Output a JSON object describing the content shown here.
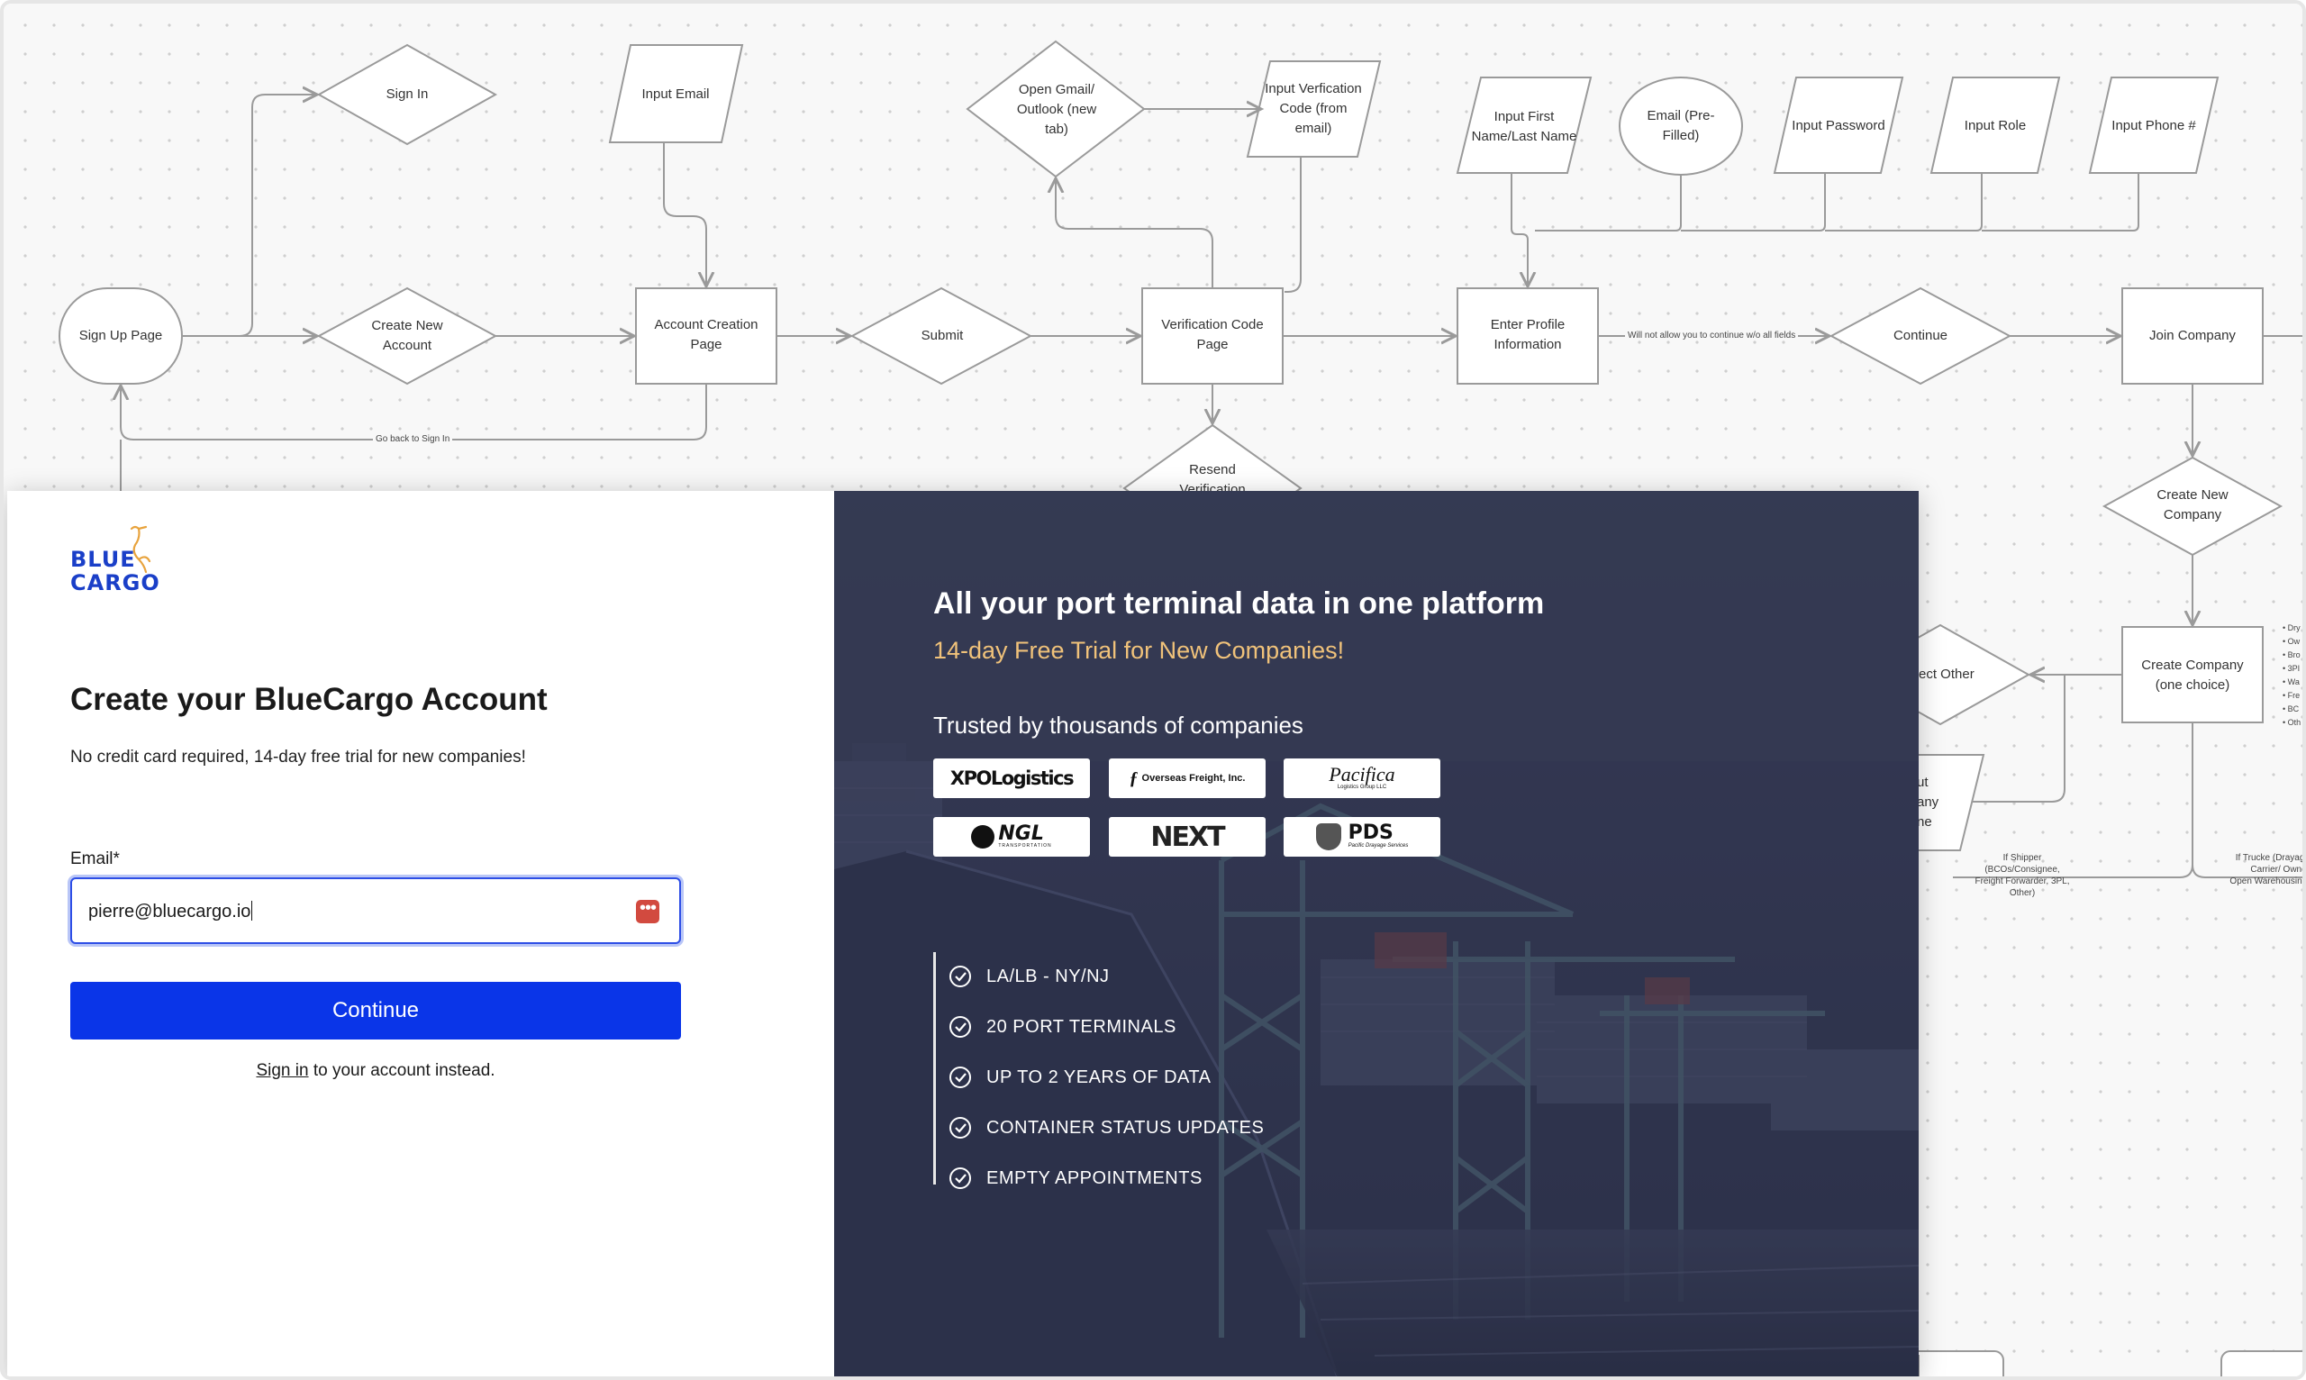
{
  "flowchart": {
    "nodes": {
      "sign_up_page": "Sign Up Page",
      "sign_in": "Sign In",
      "create_new_account": "Create New Account",
      "input_email": "Input Email",
      "account_creation_page": "Account Creation Page",
      "submit": "Submit",
      "open_gmail": "Open Gmail/ Outlook (new tab)",
      "input_verification_code": "Input Verfication Code (from email)",
      "verification_code_page": "Verification Code Page",
      "resend_verification": "Resend Verification",
      "input_first_last_name": "Input First Name/Last Name",
      "email_prefilled": "Email (Pre-Filled)",
      "input_password": "Input Password",
      "input_role": "Input Role",
      "input_phone": "Input Phone #",
      "enter_profile_information": "Enter Profile Information",
      "continue": "Continue",
      "join_company": "Join Company",
      "create_new_company": "Create New Company",
      "create_company": "Create Company (one choice)",
      "select_other": "ect Other",
      "input_company_name": "ut any ne"
    },
    "notes": {
      "go_back_to_sign_in": "Go back to Sign In",
      "will_not_allow": "Will not allow you to continue w/o all fields",
      "if_shipper": "If Shipper (BCOs/Consignee, Freight Forwarder, 3PL, Other)",
      "if_trucker": "If Trucke (Drayage Carrier/ Owner Open Warehousing, I"
    },
    "bullets": [
      "Dry",
      "Ow",
      "Bro",
      "3PI",
      "Wa",
      "Fre",
      "BC",
      "Oth"
    ]
  },
  "signup": {
    "logo": {
      "line1": "BLUE",
      "line2": "CARGO",
      "bird_icon": "heron-icon"
    },
    "title": "Create your BlueCargo Account",
    "subtitle": "No credit card required, 14-day free trial for new companies!",
    "email_label": "Email*",
    "email_value": "pierre@bluecargo.io",
    "password_manager_icon": "password-manager-icon",
    "continue_label": "Continue",
    "signin_link": "Sign in",
    "signin_rest": " to your account instead."
  },
  "promo": {
    "headline": "All your port terminal data in one platform",
    "trial": "14-day Free Trial for New Companies!",
    "trusted": "Trusted by thousands of companies",
    "partner_logos": [
      {
        "text": "XPOLogistics"
      },
      {
        "text": "Overseas Freight, Inc."
      },
      {
        "text": "Pacifica",
        "sub": "Logistics Group LLC"
      },
      {
        "text": "NGL",
        "sub": "TRANSPORTATION"
      },
      {
        "text": "NEXT"
      },
      {
        "text": "PDS",
        "sub": "Pacific Drayage Services"
      }
    ],
    "features": [
      "LA/LB - NY/NJ",
      "20 PORT TERMINALS",
      "UP TO 2 YEARS OF DATA",
      "CONTAINER STATUS UPDATES",
      "EMPTY APPOINTMENTS"
    ],
    "colors": {
      "panel": "#353a52",
      "trial": "#f0c27a",
      "button": "#0a35e8"
    }
  }
}
